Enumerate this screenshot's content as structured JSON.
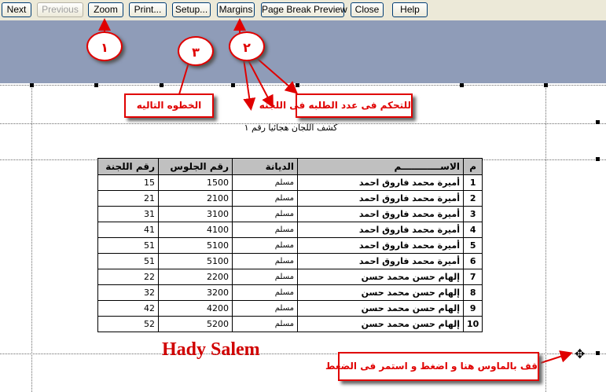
{
  "toolbar": {
    "buttons": [
      "Next",
      "Previous",
      "Zoom",
      "Print...",
      "Setup...",
      "Margins",
      "Page Break Preview",
      "Close",
      "Help"
    ]
  },
  "report": {
    "title": "كشف اللجان هجائيا رقم ١",
    "headers": {
      "num": "م",
      "name": "الاســــــــــــم",
      "religion": "الديانة",
      "seat": "رقم الجلوس",
      "committee": "رقم اللجنة"
    },
    "rows": [
      {
        "num": "1",
        "name": "أميرة محمد فاروق احمد",
        "religion": "مسلم",
        "seat": "1500",
        "committee": "15"
      },
      {
        "num": "2",
        "name": "أميرة محمد فاروق احمد",
        "religion": "مسلم",
        "seat": "2100",
        "committee": "21"
      },
      {
        "num": "3",
        "name": "أميرة محمد فاروق احمد",
        "religion": "مسلم",
        "seat": "3100",
        "committee": "31"
      },
      {
        "num": "4",
        "name": "أميرة محمد فاروق احمد",
        "religion": "مسلم",
        "seat": "4100",
        "committee": "41"
      },
      {
        "num": "5",
        "name": "أميرة محمد فاروق احمد",
        "religion": "مسلم",
        "seat": "5100",
        "committee": "51"
      },
      {
        "num": "6",
        "name": "أميرة محمد فاروق احمد",
        "religion": "مسلم",
        "seat": "5100",
        "committee": "51"
      },
      {
        "num": "7",
        "name": "إلهام حسن محمد حسن",
        "religion": "مسلم",
        "seat": "2200",
        "committee": "22"
      },
      {
        "num": "8",
        "name": "إلهام حسن محمد حسن",
        "religion": "مسلم",
        "seat": "3200",
        "committee": "32"
      },
      {
        "num": "9",
        "name": "إلهام حسن محمد حسن",
        "religion": "مسلم",
        "seat": "4200",
        "committee": "42"
      },
      {
        "num": "10",
        "name": "إلهام حسن محمد حسن",
        "religion": "مسلم",
        "seat": "5200",
        "committee": "52"
      }
    ]
  },
  "annotations": {
    "circle_1": "١",
    "circle_2": "٢",
    "circle_3": "٣",
    "next_step": "الخطوه التاليه",
    "control_students": "للتحكم فى عدد الطلبه فى اللجنه",
    "drag_hint": "قف بالماوس هنا و اضغط و استمر فى الضغط",
    "signature": "Hady Salem"
  },
  "colors": {
    "annotation_red": "#e00000",
    "header_gray": "#c0c0c0",
    "backdrop_blue": "#8f9cb8"
  },
  "icons": {
    "resize": "resize-cross-icon"
  }
}
